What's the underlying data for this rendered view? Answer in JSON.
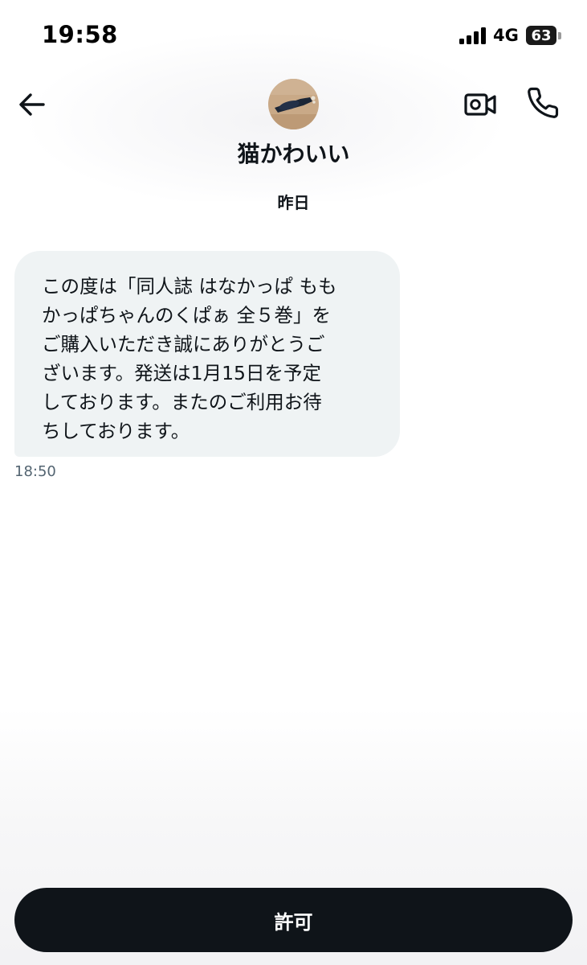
{
  "status_bar": {
    "time": "19:58",
    "network": "4G",
    "battery": "63",
    "signal_bars_filled": 4
  },
  "header": {
    "back_icon": "arrow-left-icon",
    "contact_name": "猫かわいい",
    "video_icon": "video-camera-icon",
    "call_icon": "phone-icon"
  },
  "conversation": {
    "date_separator": "昨日",
    "messages": [
      {
        "lines": [
          "この度は「同人誌 はなかっぱ もも",
          "かっぱちゃんのくぱぁ 全５巻」を",
          "ご購入いただき誠にありがとうご",
          "ざいます。発送は1月15日を予定",
          "しております。またのご利用お待",
          "ちしております。"
        ],
        "time": "18:50"
      }
    ]
  },
  "action": {
    "allow_label": "許可"
  },
  "colors": {
    "text": "#0f1419",
    "bubble": "#eff3f4",
    "secondary_text": "#536471",
    "button_bg": "#0f1419",
    "button_text": "#ffffff"
  }
}
